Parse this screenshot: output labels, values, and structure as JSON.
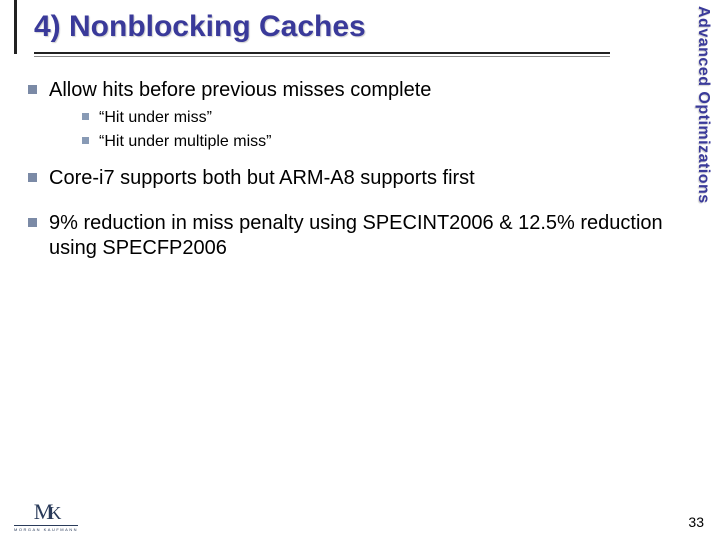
{
  "slide": {
    "title": "4) Nonblocking Caches",
    "sidebar_label": "Advanced Optimizations",
    "page_number": "33"
  },
  "bullets": [
    {
      "text": "Allow hits before previous misses complete",
      "sub": [
        "“Hit under miss”",
        "“Hit under multiple miss”"
      ]
    },
    {
      "text": "Core-i7 supports both but ARM-A8 supports first",
      "sub": []
    },
    {
      "text": "9% reduction in miss penalty using SPECINT2006 & 12.5% reduction using SPECFP2006",
      "sub": []
    }
  ],
  "logo": {
    "monogram_m": "M",
    "monogram_k": "K",
    "publisher": "MORGAN KAUFMANN"
  }
}
